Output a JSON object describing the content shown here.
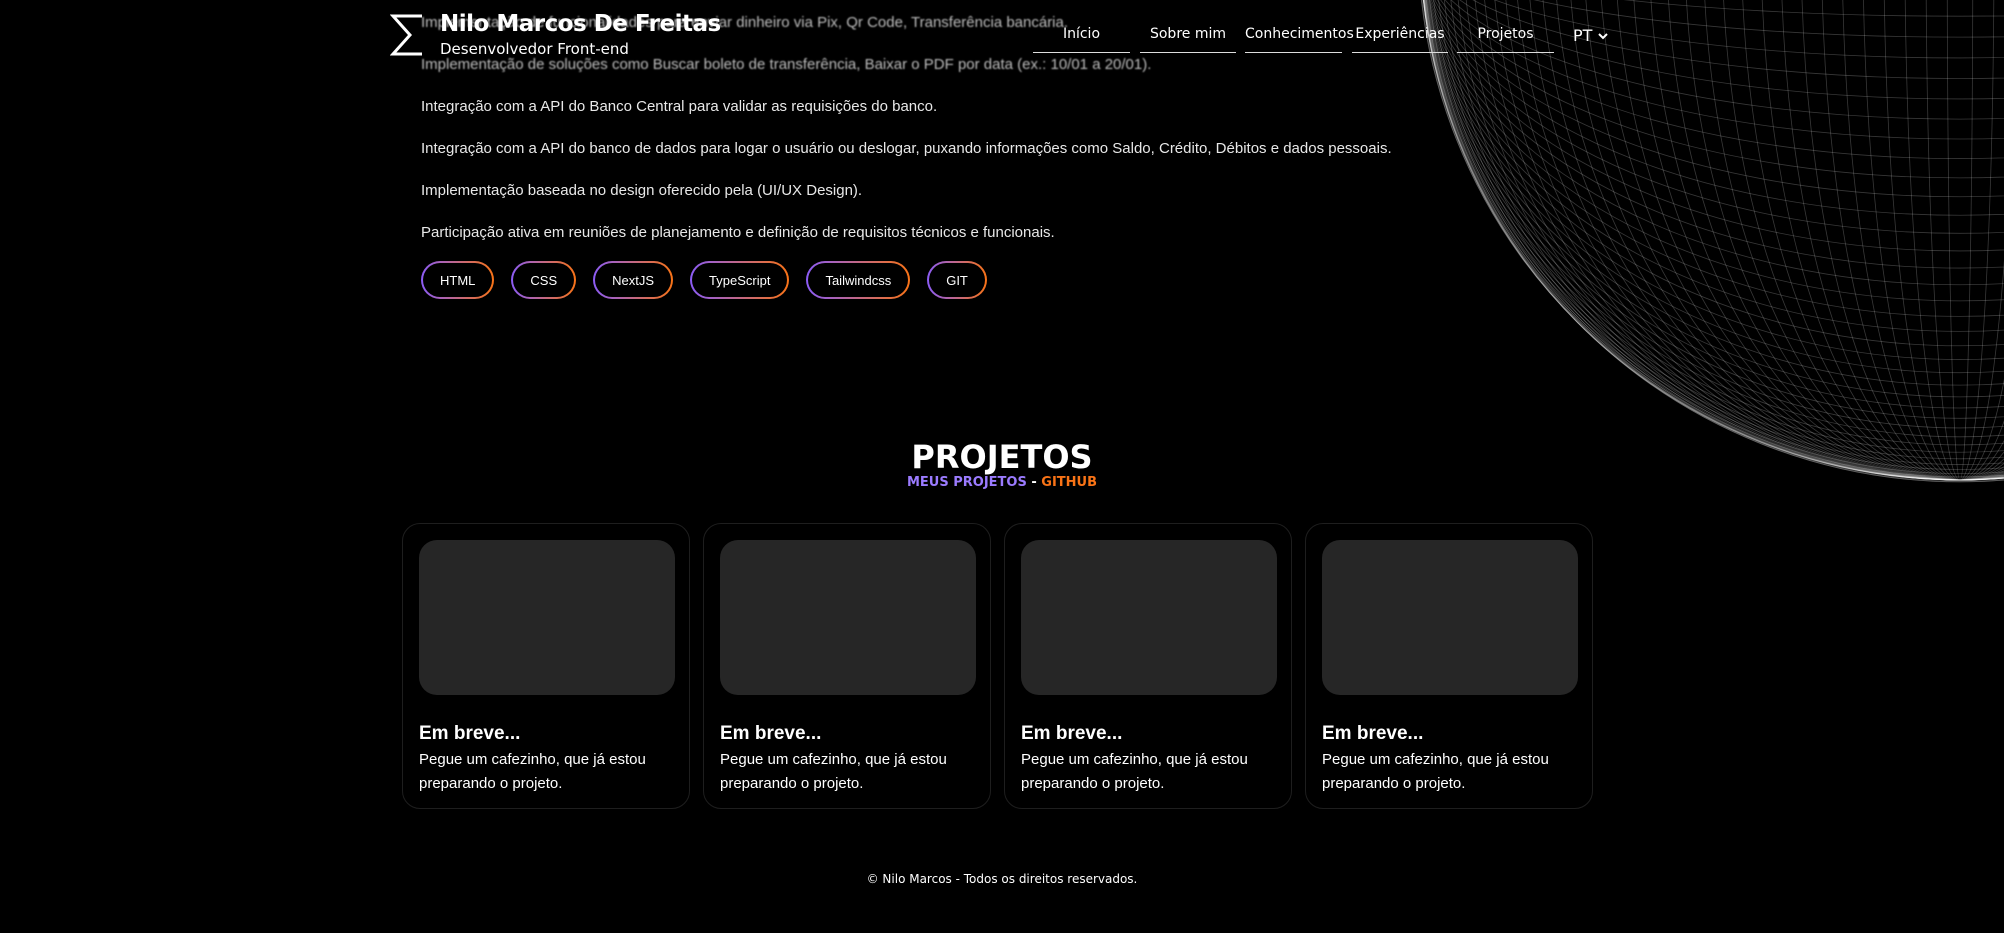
{
  "header": {
    "name": "Nilo Marcos De Freitas",
    "role": "Desenvolvedor Front-end",
    "nav": [
      "Início",
      "Sobre mim",
      "Conhecimentos",
      "Experiências",
      "Projetos"
    ],
    "language": "PT"
  },
  "experience": {
    "lines": [
      "Implementação de funcionalidades para enviar dinheiro via Pix, Qr Code, Transferência bancária.",
      "Implementação de soluções como Buscar boleto de transferência, Baixar o PDF por data (ex.: 10/01 a 20/01).",
      "Integração com a API do Banco Central para validar as requisições do banco.",
      "Integração com a API do banco de dados para logar o usuário ou deslogar, puxando informações como Saldo, Crédito, Débitos e dados pessoais.",
      "Implementação baseada no design oferecido pela (UI/UX Design).",
      "Participação ativa em reuniões de planejamento e definição de requisitos técnicos e funcionais."
    ],
    "tags": [
      "HTML",
      "CSS",
      "NextJS",
      "TypeScript",
      "Tailwindcss",
      "GIT"
    ]
  },
  "projects": {
    "title": "PROJETOS",
    "subtitle_a": "MEUS PROJETOS",
    "subtitle_sep": " - ",
    "subtitle_b": "GITHUB",
    "cards": [
      {
        "title": "Em breve...",
        "desc": "Pegue um cafezinho, que já estou preparando o projeto."
      },
      {
        "title": "Em breve...",
        "desc": "Pegue um cafezinho, que já estou preparando o projeto."
      },
      {
        "title": "Em breve...",
        "desc": "Pegue um cafezinho, que já estou preparando o projeto."
      },
      {
        "title": "Em breve...",
        "desc": "Pegue um cafezinho, que já estou preparando o projeto."
      }
    ]
  },
  "footer": {
    "text": "© Nilo Marcos - Todos os direitos reservados."
  },
  "colors": {
    "background": "#000000",
    "accent_purple": "#8b5cf6",
    "accent_orange": "#f97316",
    "card_thumb": "#262626"
  },
  "icons": {
    "logo": "sigma-logo-icon",
    "language_dropdown": "chevron-down-icon"
  }
}
